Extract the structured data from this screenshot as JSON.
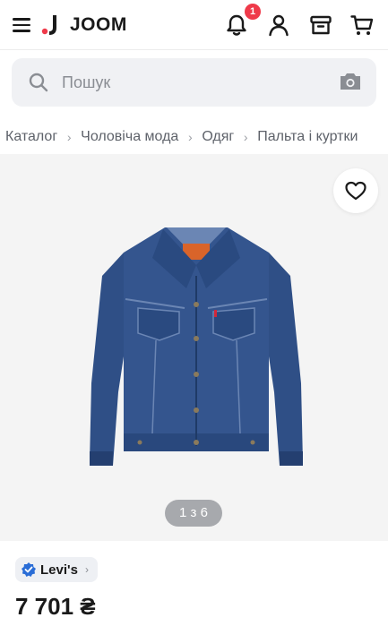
{
  "header": {
    "brand": "JOOM",
    "notification_count": "1",
    "icons": [
      "menu-icon",
      "joom-logo",
      "bell-icon",
      "user-icon",
      "archive-box-icon",
      "cart-icon"
    ]
  },
  "search": {
    "placeholder": "Пошук",
    "icons": [
      "search-icon",
      "camera-icon"
    ]
  },
  "breadcrumb": {
    "items": [
      "Каталог",
      "Чоловіча мода",
      "Одяг",
      "Пальта і куртки"
    ]
  },
  "gallery": {
    "indicator": "1 з 6",
    "icons": [
      "heart-icon"
    ]
  },
  "product": {
    "brand": "Levi's",
    "price": "7 701 ₴",
    "icons": [
      "verified-icon",
      "chevron-right-icon"
    ]
  },
  "colors": {
    "badge": "#ef3a4a",
    "logo_accent": "#ef3a4a",
    "verified": "#2a6dd6",
    "denim": "#2f4f86"
  }
}
